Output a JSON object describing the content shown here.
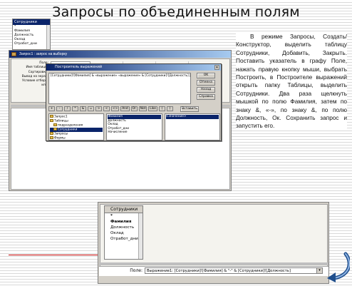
{
  "slide": {
    "title": "Запросы по объединенным полям",
    "description": "В режиме Запросы, Создать/Конструктор, выделить таблицу Сотрудники, Добавить, Закрыть. Поставить указатель в графу Поле, нажать правую кнопку мыши, выбрать Построить, в Построителе выражений открыть папку Таблицы, выделить Сотрудники. Два раза щелкнуть мышкой по полю Фамилия, затем по знаку &, «-», по знаку &, по полю Должность, Ок. Сохранить запрос и запустить его."
  },
  "designer": {
    "window_title": "Запрос1 : запрос на выборку",
    "table": {
      "name": "Сотрудники",
      "fields": [
        "*",
        "Фамилия",
        "Должность",
        "Оклад",
        "Отработ_дни"
      ]
    },
    "grid_labels": [
      "Поле:",
      "Имя таблицы:",
      "Сортировка:",
      "Вывод на экран:",
      "Условие отбора:",
      "или:"
    ]
  },
  "builder": {
    "title": "Построитель выражений",
    "expression": "[Сотрудники]![Фамилия] & «выражение» «выражение» & [Сотрудники]![Должность] |",
    "buttons": {
      "ok": "OK",
      "cancel": "Отмена",
      "back": "Назад",
      "help": "Справка",
      "paste": "Вставить"
    },
    "operators": [
      "+",
      "-",
      "/",
      "*",
      "&",
      "=",
      ">",
      "<",
      "<>",
      "And",
      "Or",
      "Not",
      "Like",
      "(",
      ")"
    ],
    "folders": [
      "Запрос1",
      "Таблицы",
      "подразделения",
      "Сотрудники",
      "Запросы",
      "Формы",
      "Отчеты",
      "Функции",
      "Константы"
    ],
    "fields_list": [
      "Фамилия",
      "Должность",
      "Оклад",
      "Отработ_дни",
      "Начисление"
    ],
    "values_list": [
      "<Значение>"
    ]
  },
  "result": {
    "table": {
      "name": "Сотрудники",
      "fields": [
        "*",
        "Фамилия",
        "Должность",
        "Оклад",
        "Отработ_дни"
      ]
    },
    "field_label": "Поле:",
    "field_value": "Выражение1: [Сотрудники]![Фамилия] & \"-\" & [Сотрудники]![Должность]"
  },
  "colors": {
    "accent_line": "#c00000",
    "nav_arrow": "#1f4e8c",
    "dialog_title": "#0a246a"
  }
}
